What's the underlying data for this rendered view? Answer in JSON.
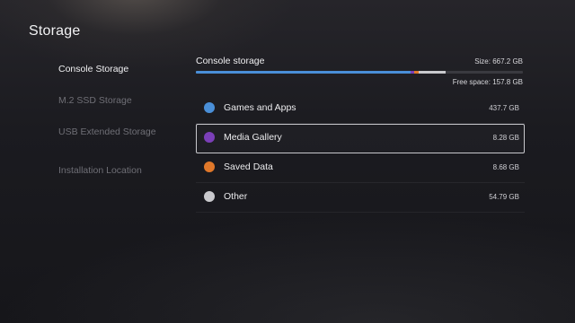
{
  "page": {
    "title": "Storage"
  },
  "sidebar": {
    "items": [
      {
        "label": "Console Storage",
        "active": true
      },
      {
        "label": "M.2 SSD Storage",
        "active": false
      },
      {
        "label": "USB Extended Storage",
        "active": false
      },
      {
        "label": "Installation Location",
        "active": false
      }
    ]
  },
  "storage": {
    "title": "Console storage",
    "size_text": "Size: 667.2 GB",
    "free_text": "Free space: 157.8 GB",
    "track_color": "#3a3a40",
    "items": [
      {
        "label": "Games and Apps",
        "value": "437.7 GB",
        "gb": 437.7,
        "color": "#4a8fd8",
        "focused": false
      },
      {
        "label": "Media Gallery",
        "value": "8.28 GB",
        "gb": 8.28,
        "color": "#7b3fb8",
        "focused": true
      },
      {
        "label": "Saved Data",
        "value": "8.68 GB",
        "gb": 8.68,
        "color": "#e0782a",
        "focused": false
      },
      {
        "label": "Other",
        "value": "54.79 GB",
        "gb": 54.79,
        "color": "#c9c9cd",
        "focused": false
      }
    ],
    "total_gb": 667.2
  }
}
